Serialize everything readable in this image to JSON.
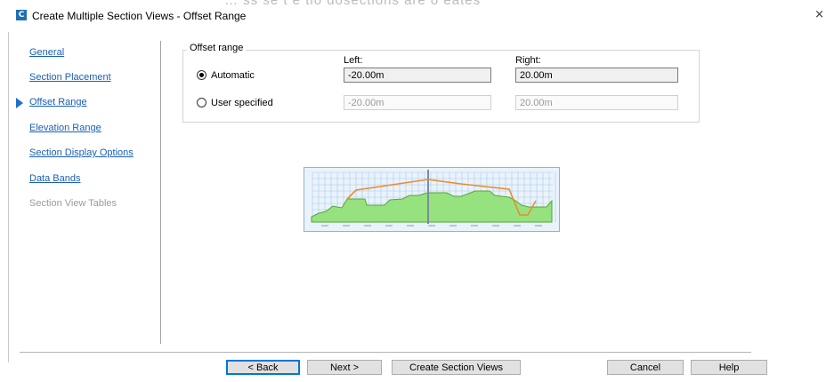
{
  "window": {
    "title": "Create Multiple Section Views - Offset Range",
    "ghost_text": "… ss se t e tio dosections are o eates",
    "close_glyph": "×",
    "icon_letter": "C"
  },
  "nav": {
    "items": [
      {
        "label": "General",
        "enabled": true,
        "active": false
      },
      {
        "label": "Section Placement",
        "enabled": true,
        "active": false
      },
      {
        "label": "Offset Range",
        "enabled": true,
        "active": true
      },
      {
        "label": "Elevation Range",
        "enabled": true,
        "active": false
      },
      {
        "label": "Section Display Options",
        "enabled": true,
        "active": false
      },
      {
        "label": "Data Bands",
        "enabled": true,
        "active": false
      },
      {
        "label": "Section View Tables",
        "enabled": false,
        "active": false
      }
    ]
  },
  "offset_range": {
    "group_label": "Offset range",
    "left_label": "Left:",
    "right_label": "Right:",
    "automatic": {
      "label": "Automatic",
      "selected": true,
      "left_value": "-20.00m",
      "right_value": "20.00m"
    },
    "user_specified": {
      "label": "User specified",
      "selected": false,
      "left_value": "-20.00m",
      "right_value": "20.00m"
    }
  },
  "preview": {
    "colors": {
      "background": "#eaf3fb",
      "border": "#8fb3d9",
      "grid": "#a9c9ea",
      "ground_fill": "#96e27e",
      "ground_line": "#54a63a",
      "design_line": "#ee8a2c",
      "centerline": "#7d8a99"
    }
  },
  "buttons": {
    "back": "< Back",
    "next": "Next >",
    "create": "Create Section Views",
    "cancel": "Cancel",
    "help": "Help"
  }
}
